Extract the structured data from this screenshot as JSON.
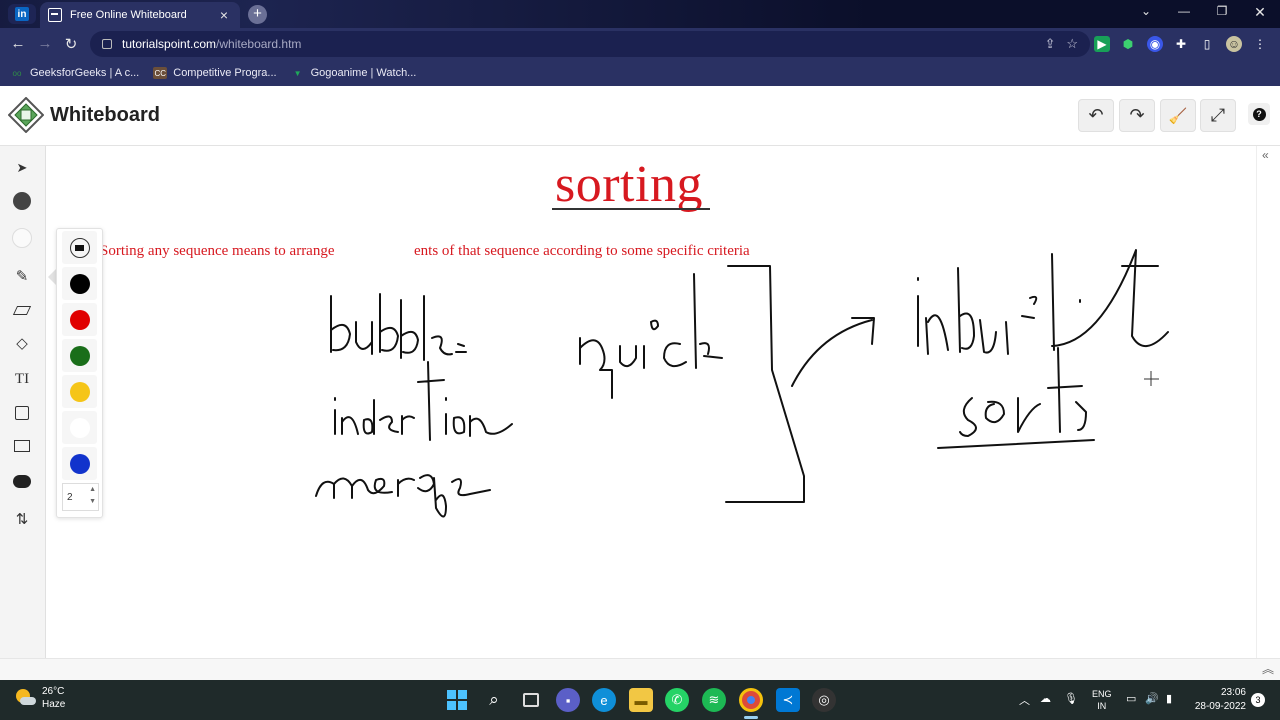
{
  "browser": {
    "tab_title": "Free Online Whiteboard",
    "linkedin_badge": "in",
    "url_host": "tutorialspoint.com",
    "url_path": "/whiteboard.htm",
    "bookmarks": [
      {
        "label": "GeeksforGeeks | A c...",
        "icon": "geeksforgeeks-icon",
        "color": "#2f8d46",
        "glyph": "oo"
      },
      {
        "label": "Competitive Progra...",
        "icon": "codechef-icon",
        "color": "#6b4f3a",
        "glyph": "CC"
      },
      {
        "label": "Gogoanime | Watch...",
        "icon": "gogoanime-icon",
        "color": "#1fa85a",
        "glyph": "▼"
      }
    ]
  },
  "app": {
    "brand": "Whiteboard",
    "header_buttons": [
      "undo-icon",
      "redo-icon",
      "clear-brush-icon",
      "fullscreen-icon"
    ],
    "help_glyph": "?"
  },
  "tools": [
    {
      "name": "select-tool",
      "glyph": "➤"
    },
    {
      "name": "color-tool",
      "glyph": "●"
    },
    {
      "name": "background-color-tool",
      "glyph": "○"
    },
    {
      "name": "pencil-tool",
      "glyph": "✎"
    },
    {
      "name": "eraser-tool",
      "glyph": "⌫"
    },
    {
      "name": "shapes-tool",
      "glyph": "◇"
    },
    {
      "name": "text-tool",
      "glyph": "TI"
    },
    {
      "name": "image-tool",
      "glyph": "▣"
    },
    {
      "name": "background-image-tool",
      "glyph": "▨"
    },
    {
      "name": "chat-tool",
      "glyph": "💬"
    },
    {
      "name": "import-export-tool",
      "glyph": "⇅"
    }
  ],
  "palette": {
    "colors": [
      "#000000",
      "#e00000",
      "#1a6e1a",
      "#f5c518",
      "#ffffff",
      "#1133cc"
    ],
    "stroke_size": "2"
  },
  "canvas": {
    "title": "sorting",
    "definition_left": "Sorting any sequence means to arrange",
    "definition_right": "ents of that sequence according to some specific criteria",
    "handwriting": [
      "bubble",
      "insertion",
      "merge",
      "quick",
      "Inbuilt",
      "sort"
    ]
  },
  "taskbar": {
    "temperature": "26°C",
    "condition": "Haze",
    "language": "ENG",
    "region": "IN",
    "time": "23:06",
    "date": "28-09-2022",
    "notifications": "3"
  },
  "colors": {
    "accent_red": "#d71920",
    "chrome_bg": "#2a3163",
    "taskbar_bg": "#1f2a2a"
  }
}
